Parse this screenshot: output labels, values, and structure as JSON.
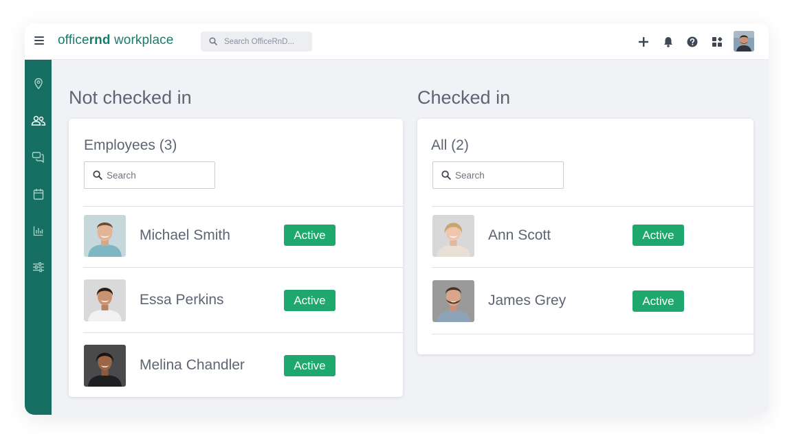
{
  "app": {
    "brand_light": "office",
    "brand_bold": "rnd",
    "brand_suffix": " workplace",
    "search_placeholder": "Search OfficeRnD..."
  },
  "topbar_icons": [
    "add-icon",
    "bell-icon",
    "help-icon",
    "apps-icon"
  ],
  "sidebar": {
    "items": [
      "location-icon",
      "people-icon",
      "chat-icon",
      "calendar-icon",
      "analytics-icon",
      "settings-sliders-icon"
    ],
    "active_index": 1
  },
  "sections": {
    "not_checked_in": {
      "title": "Not checked in",
      "card_title": "Employees (3)",
      "search_placeholder": "Search",
      "people": [
        {
          "name": "Michael Smith",
          "status": "Active"
        },
        {
          "name": "Essa Perkins",
          "status": "Active"
        },
        {
          "name": "Melina Chandler",
          "status": "Active"
        }
      ]
    },
    "checked_in": {
      "title": "Checked in",
      "card_title": "All (2)",
      "search_placeholder": "Search",
      "people": [
        {
          "name": "Ann Scott",
          "status": "Active"
        },
        {
          "name": "James Grey",
          "status": "Active"
        }
      ]
    }
  },
  "colors": {
    "brand": "#1b7a6a",
    "sidebar": "#166f62",
    "active_badge": "#1ea86e",
    "text": "#5d6472",
    "background": "#f1f2f6"
  }
}
